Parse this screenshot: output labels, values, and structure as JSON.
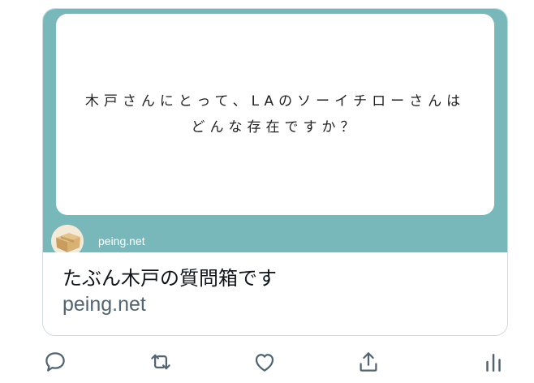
{
  "card": {
    "question_line1": "木戸さんにとって、LAのソーイチローさんは",
    "question_line2": "どんな存在ですか？",
    "brand_small": "peing.net",
    "title": "たぶん木戸の質問箱です",
    "domain": "peing.net"
  },
  "icons": {
    "reply": "reply-icon",
    "retweet": "retweet-icon",
    "like": "like-icon",
    "share": "share-icon",
    "analytics": "analytics-icon"
  },
  "colors": {
    "preview_background": "#78b7ba",
    "icon": "#536471",
    "title": "#0f1419",
    "domain": "#536471"
  }
}
